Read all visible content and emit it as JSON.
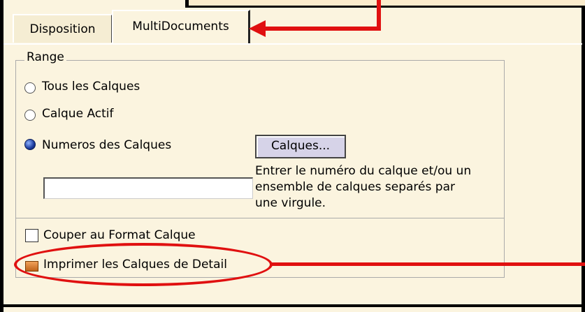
{
  "tabs": [
    {
      "label": "Disposition"
    },
    {
      "label": "MultiDocuments"
    }
  ],
  "range": {
    "group_label": "Range",
    "options": [
      {
        "label": "Tous les Calques",
        "checked": false
      },
      {
        "label": "Calque Actif",
        "checked": false
      },
      {
        "label": "Numeros des Calques",
        "checked": true
      }
    ],
    "calques_button": "Calques...",
    "layer_input_value": "",
    "help_lines": [
      "Entrer le numéro du calque et/ou un",
      "ensemble de calques separés par",
      "une virgule."
    ]
  },
  "options": {
    "couper_label": "Couper au Format Calque",
    "imprimer_label": "Imprimer les Calques de Detail"
  },
  "colors": {
    "panel_bg": "#fbf4df",
    "annotation_red": "#e01010",
    "radio_selected": "#1a3a9c"
  }
}
